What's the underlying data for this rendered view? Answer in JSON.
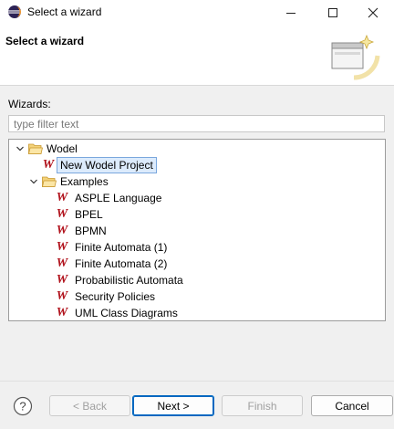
{
  "window": {
    "title": "Select a wizard",
    "icon": "eclipse-icon"
  },
  "header": {
    "title": "Select a wizard"
  },
  "wizards_label": "Wizards:",
  "filter": {
    "placeholder": "type filter text",
    "value": ""
  },
  "tree": {
    "wodel": "Wodel",
    "new_project": "New Wodel Project",
    "examples": "Examples",
    "items": [
      "ASPLE Language",
      "BPEL",
      "BPMN",
      "Finite Automata (1)",
      "Finite Automata (2)",
      "Probabilistic Automata",
      "Security Policies",
      "UML Class Diagrams"
    ],
    "item_icon_glyph": "W"
  },
  "buttons": {
    "back": "< Back",
    "next": "Next >",
    "finish": "Finish",
    "cancel": "Cancel"
  },
  "colors": {
    "wodel_icon": "#b0101a",
    "selection": "#dcebfc",
    "default_button_border": "#0067c0",
    "folder": "#e8b84a"
  }
}
